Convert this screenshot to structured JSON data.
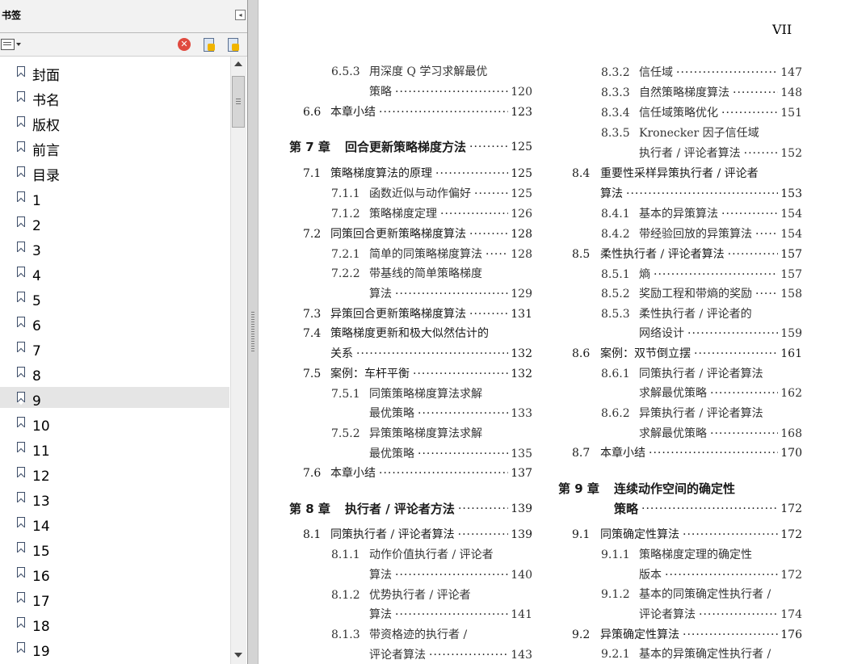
{
  "panel": {
    "title": "书签",
    "collapse_icon": "◂",
    "delete_icon": "✕",
    "selected_index": 13,
    "bookmarks": [
      "封面",
      "书名",
      "版权",
      "前言",
      "目录",
      "1",
      "2",
      "3",
      "4",
      "5",
      "6",
      "7",
      "8",
      "9",
      "10",
      "11",
      "12",
      "13",
      "14",
      "15",
      "16",
      "17",
      "18",
      "19"
    ]
  },
  "page": {
    "page_number": "VII",
    "leader_char": "·",
    "toc": [
      {
        "num": "6.5.3",
        "title": "用深度 Q 学习求解最优",
        "page": "",
        "col": 0,
        "level": 3
      },
      {
        "num": "",
        "title": "策略",
        "page": "120",
        "col": 0,
        "level": 3,
        "cont": true
      },
      {
        "num": "6.6",
        "title": "本章小结",
        "page": "123",
        "col": 0,
        "level": 2
      },
      {
        "num": "第 7 章",
        "title": "回合更新策略梯度方法",
        "page": "125",
        "col": 0,
        "level": 1
      },
      {
        "num": "7.1",
        "title": "策略梯度算法的原理",
        "page": "125",
        "col": 0,
        "level": 2
      },
      {
        "num": "7.1.1",
        "title": "函数近似与动作偏好",
        "page": "125",
        "col": 0,
        "level": 3
      },
      {
        "num": "7.1.2",
        "title": "策略梯度定理",
        "page": "126",
        "col": 0,
        "level": 3
      },
      {
        "num": "7.2",
        "title": "同策回合更新策略梯度算法",
        "page": "128",
        "col": 0,
        "level": 2
      },
      {
        "num": "7.2.1",
        "title": "简单的同策略梯度算法",
        "page": "128",
        "col": 0,
        "level": 3
      },
      {
        "num": "7.2.2",
        "title": "带基线的简单策略梯度",
        "page": "",
        "col": 0,
        "level": 3
      },
      {
        "num": "",
        "title": "算法",
        "page": "129",
        "col": 0,
        "level": 3,
        "cont": true
      },
      {
        "num": "7.3",
        "title": "异策回合更新策略梯度算法",
        "page": "131",
        "col": 0,
        "level": 2
      },
      {
        "num": "7.4",
        "title": "策略梯度更新和极大似然估计的",
        "page": "",
        "col": 0,
        "level": 2
      },
      {
        "num": "",
        "title": "关系",
        "page": "132",
        "col": 0,
        "level": 2,
        "cont": true
      },
      {
        "num": "7.5",
        "title": "案例：车杆平衡",
        "page": "132",
        "col": 0,
        "level": 2
      },
      {
        "num": "7.5.1",
        "title": "同策策略梯度算法求解",
        "page": "",
        "col": 0,
        "level": 3
      },
      {
        "num": "",
        "title": "最优策略",
        "page": "133",
        "col": 0,
        "level": 3,
        "cont": true
      },
      {
        "num": "7.5.2",
        "title": "异策策略梯度算法求解",
        "page": "",
        "col": 0,
        "level": 3
      },
      {
        "num": "",
        "title": "最优策略",
        "page": "135",
        "col": 0,
        "level": 3,
        "cont": true
      },
      {
        "num": "7.6",
        "title": "本章小结",
        "page": "137",
        "col": 0,
        "level": 2
      },
      {
        "num": "第 8 章",
        "title": "执行者 / 评论者方法",
        "page": "139",
        "col": 0,
        "level": 1
      },
      {
        "num": "8.1",
        "title": "同策执行者 / 评论者算法",
        "page": "139",
        "col": 0,
        "level": 2
      },
      {
        "num": "8.1.1",
        "title": "动作价值执行者 / 评论者",
        "page": "",
        "col": 0,
        "level": 3
      },
      {
        "num": "",
        "title": "算法",
        "page": "140",
        "col": 0,
        "level": 3,
        "cont": true
      },
      {
        "num": "8.1.2",
        "title": "优势执行者 / 评论者",
        "page": "",
        "col": 0,
        "level": 3
      },
      {
        "num": "",
        "title": "算法",
        "page": "141",
        "col": 0,
        "level": 3,
        "cont": true
      },
      {
        "num": "8.1.3",
        "title": "带资格迹的执行者 /",
        "page": "",
        "col": 0,
        "level": 3
      },
      {
        "num": "",
        "title": "评论者算法",
        "page": "143",
        "col": 0,
        "level": 3,
        "cont": true
      },
      {
        "num": "8.3.2",
        "title": "信任域",
        "page": "147",
        "col": 1,
        "level": 3
      },
      {
        "num": "8.3.3",
        "title": "自然策略梯度算法",
        "page": "148",
        "col": 1,
        "level": 3
      },
      {
        "num": "8.3.4",
        "title": "信任域策略优化",
        "page": "151",
        "col": 1,
        "level": 3
      },
      {
        "num": "8.3.5",
        "title": "Kronecker 因子信任域",
        "page": "",
        "col": 1,
        "level": 3
      },
      {
        "num": "",
        "title": "执行者 / 评论者算法",
        "page": "152",
        "col": 1,
        "level": 3,
        "cont": true
      },
      {
        "num": "8.4",
        "title": "重要性采样异策执行者 / 评论者",
        "page": "",
        "col": 1,
        "level": 2
      },
      {
        "num": "",
        "title": "算法",
        "page": "153",
        "col": 1,
        "level": 2,
        "cont": true
      },
      {
        "num": "8.4.1",
        "title": "基本的异策算法",
        "page": "154",
        "col": 1,
        "level": 3
      },
      {
        "num": "8.4.2",
        "title": "带经验回放的异策算法",
        "page": "154",
        "col": 1,
        "level": 3
      },
      {
        "num": "8.5",
        "title": "柔性执行者 / 评论者算法",
        "page": "157",
        "col": 1,
        "level": 2
      },
      {
        "num": "8.5.1",
        "title": "熵",
        "page": "157",
        "col": 1,
        "level": 3
      },
      {
        "num": "8.5.2",
        "title": "奖励工程和带熵的奖励",
        "page": "158",
        "col": 1,
        "level": 3
      },
      {
        "num": "8.5.3",
        "title": "柔性执行者 / 评论者的",
        "page": "",
        "col": 1,
        "level": 3
      },
      {
        "num": "",
        "title": "网络设计",
        "page": "159",
        "col": 1,
        "level": 3,
        "cont": true
      },
      {
        "num": "8.6",
        "title": "案例：双节倒立摆",
        "page": "161",
        "col": 1,
        "level": 2
      },
      {
        "num": "8.6.1",
        "title": "同策执行者 / 评论者算法",
        "page": "",
        "col": 1,
        "level": 3
      },
      {
        "num": "",
        "title": "求解最优策略",
        "page": "162",
        "col": 1,
        "level": 3,
        "cont": true
      },
      {
        "num": "8.6.2",
        "title": "异策执行者 / 评论者算法",
        "page": "",
        "col": 1,
        "level": 3
      },
      {
        "num": "",
        "title": "求解最优策略",
        "page": "168",
        "col": 1,
        "level": 3,
        "cont": true
      },
      {
        "num": "8.7",
        "title": "本章小结",
        "page": "170",
        "col": 1,
        "level": 2
      },
      {
        "num": "第 9 章",
        "title": "连续动作空间的确定性",
        "page": "",
        "col": 1,
        "level": 1
      },
      {
        "num": "",
        "title": "策略",
        "page": "172",
        "col": 1,
        "level": 1,
        "cont": true
      },
      {
        "num": "9.1",
        "title": "同策确定性算法",
        "page": "172",
        "col": 1,
        "level": 2
      },
      {
        "num": "9.1.1",
        "title": "策略梯度定理的确定性",
        "page": "",
        "col": 1,
        "level": 3
      },
      {
        "num": "",
        "title": "版本",
        "page": "172",
        "col": 1,
        "level": 3,
        "cont": true
      },
      {
        "num": "9.1.2",
        "title": "基本的同策确定性执行者 /",
        "page": "",
        "col": 1,
        "level": 3
      },
      {
        "num": "",
        "title": "评论者算法",
        "page": "174",
        "col": 1,
        "level": 3,
        "cont": true
      },
      {
        "num": "9.2",
        "title": "异策确定性算法",
        "page": "176",
        "col": 1,
        "level": 2
      },
      {
        "num": "9.2.1",
        "title": "基本的异策确定性执行者 /",
        "page": "",
        "col": 1,
        "level": 3
      }
    ]
  }
}
